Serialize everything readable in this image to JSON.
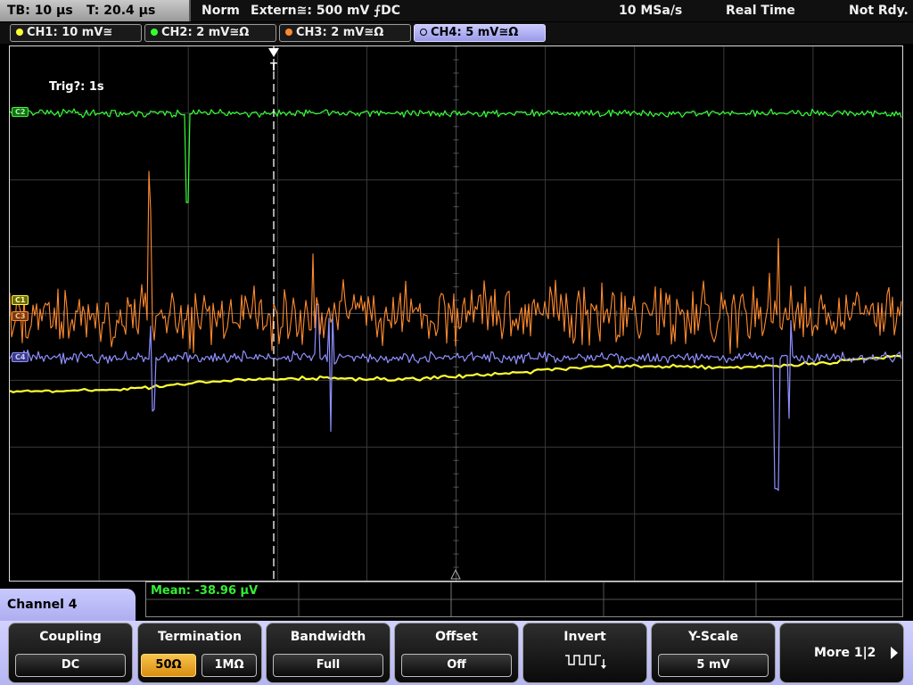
{
  "status_bar": {
    "timebase": "TB: 10 µs",
    "trigger_time": "T: 20.4 µs",
    "mode": "Norm",
    "trigger_source": "Extern≅: 500 mV ⨍DC",
    "sample_rate": "10 MSa/s",
    "acq_mode": "Real Time",
    "status": "Not Rdy."
  },
  "channel_tabs": [
    {
      "label": "CH1: 10 mV≅",
      "color": "#ffff33"
    },
    {
      "label": "CH2: 2 mV≅Ω",
      "color": "#33ff33"
    },
    {
      "label": "CH3: 2 mV≅Ω",
      "color": "#ff8a2e"
    },
    {
      "label": "CH4: 5 mV≅Ω",
      "color": "#8f8fff",
      "active": true
    }
  ],
  "screen": {
    "trigger_label": "Trig?: 1s",
    "trigger_marker": "T",
    "markers": {
      "ch1": "C1",
      "ch2": "C2",
      "ch3": "C3",
      "ch4": "C4"
    }
  },
  "measurement": {
    "mean": "Mean: -38.96 µV"
  },
  "menu": {
    "channel_label": "Channel 4",
    "softkeys": {
      "coupling": {
        "title": "Coupling",
        "value": "DC"
      },
      "termination": {
        "title": "Termination",
        "option_a": "50Ω",
        "option_b": "1MΩ",
        "selected": "50Ω"
      },
      "bandwidth": {
        "title": "Bandwidth",
        "value": "Full"
      },
      "offset": {
        "title": "Offset",
        "value": "Off"
      },
      "invert": {
        "title": "Invert",
        "icon": "invert-square-wave-icon"
      },
      "yscale": {
        "title": "Y-Scale",
        "value": "5 mV"
      },
      "more": {
        "label": "More 1|2"
      }
    }
  }
}
